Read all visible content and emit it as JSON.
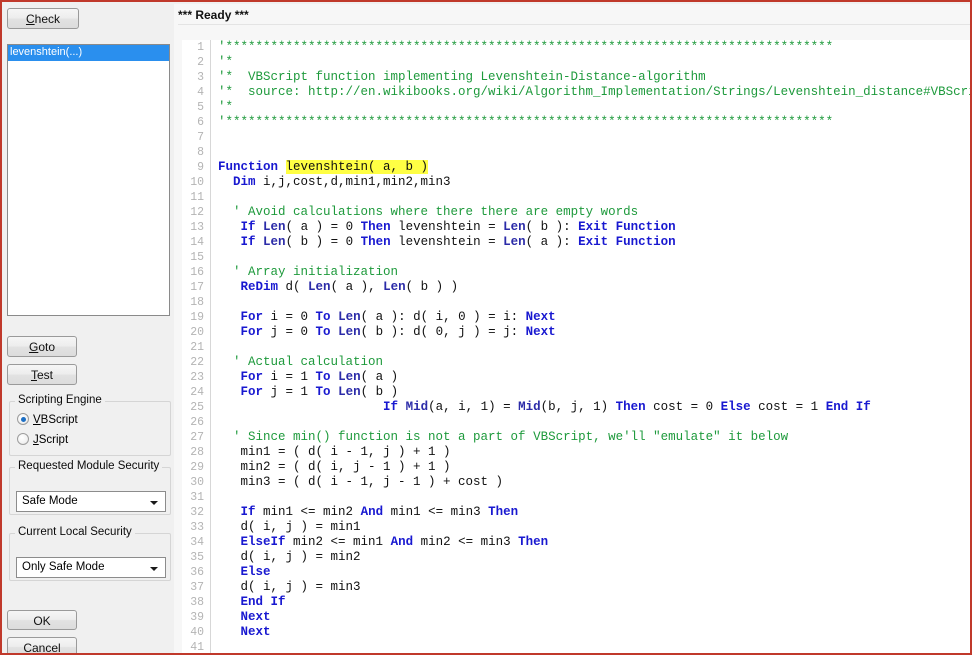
{
  "window": {
    "border_color": "#c0392b"
  },
  "sidebar": {
    "check_button": {
      "label": "Check",
      "accel": "C"
    },
    "function_list": {
      "items": [
        {
          "label": "levenshtein(...)",
          "selected": true
        }
      ]
    },
    "goto_button": {
      "label": "Goto",
      "accel": "G"
    },
    "test_button": {
      "label": "Test",
      "accel": "T"
    },
    "scripting_engine": {
      "title": "Scripting Engine",
      "options": [
        {
          "label": "VBScript",
          "accel": "V",
          "checked": true
        },
        {
          "label": "JScript",
          "accel": "J",
          "checked": false
        }
      ]
    },
    "module_security": {
      "title": "Requested Module Security",
      "value": "Safe Mode",
      "options": [
        "Safe Mode"
      ]
    },
    "local_security": {
      "title": "Current Local Security",
      "value": "Only Safe Mode",
      "options": [
        "Only Safe Mode"
      ]
    },
    "ok_button": {
      "label": "OK"
    },
    "cancel_button": {
      "label": "Cancel",
      "accel": "a"
    }
  },
  "editor": {
    "status": "*** Ready ***",
    "language": "VBScript",
    "colors": {
      "comment": "#1e9a3c",
      "keyword": "#1818d0",
      "builtin": "#2b2ba8",
      "identifier": "#101010",
      "highlight_bg": "#ffff44",
      "gutter_text": "#b4b4b4",
      "background": "#ffffff"
    },
    "lines": [
      {
        "n": 1,
        "tokens": [
          {
            "t": "cm",
            "s": "'*********************************************************************************"
          }
        ]
      },
      {
        "n": 2,
        "tokens": [
          {
            "t": "cm",
            "s": "'*"
          }
        ]
      },
      {
        "n": 3,
        "tokens": [
          {
            "t": "cm",
            "s": "'*  VBScript function implementing Levenshtein-Distance-algorithm"
          }
        ]
      },
      {
        "n": 4,
        "tokens": [
          {
            "t": "cm",
            "s": "'*  source: http://en.wikibooks.org/wiki/Algorithm_Implementation/Strings/Levenshtein_distance#VBScript"
          }
        ]
      },
      {
        "n": 5,
        "tokens": [
          {
            "t": "cm",
            "s": "'*"
          }
        ]
      },
      {
        "n": 6,
        "tokens": [
          {
            "t": "cm",
            "s": "'*********************************************************************************"
          }
        ]
      },
      {
        "n": 7,
        "tokens": []
      },
      {
        "n": 8,
        "tokens": []
      },
      {
        "n": 9,
        "tokens": [
          {
            "t": "kw",
            "s": "Function"
          },
          {
            "t": "id",
            "s": " "
          },
          {
            "t": "hl",
            "s": "levenshtein( a, b )"
          }
        ]
      },
      {
        "n": 10,
        "tokens": [
          {
            "t": "id",
            "s": "  "
          },
          {
            "t": "kw",
            "s": "Dim"
          },
          {
            "t": "id",
            "s": " i,j,cost,d,min1,min2,min3"
          }
        ]
      },
      {
        "n": 11,
        "tokens": []
      },
      {
        "n": 12,
        "tokens": [
          {
            "t": "id",
            "s": "  "
          },
          {
            "t": "cm",
            "s": "' Avoid calculations where there there are empty words"
          }
        ]
      },
      {
        "n": 13,
        "tokens": [
          {
            "t": "id",
            "s": "   "
          },
          {
            "t": "kw",
            "s": "If"
          },
          {
            "t": "id",
            "s": " "
          },
          {
            "t": "fn",
            "s": "Len"
          },
          {
            "t": "id",
            "s": "( a ) = 0 "
          },
          {
            "t": "kw",
            "s": "Then"
          },
          {
            "t": "id",
            "s": " levenshtein = "
          },
          {
            "t": "fn",
            "s": "Len"
          },
          {
            "t": "id",
            "s": "( b ): "
          },
          {
            "t": "kw",
            "s": "Exit Function"
          }
        ]
      },
      {
        "n": 14,
        "tokens": [
          {
            "t": "id",
            "s": "   "
          },
          {
            "t": "kw",
            "s": "If"
          },
          {
            "t": "id",
            "s": " "
          },
          {
            "t": "fn",
            "s": "Len"
          },
          {
            "t": "id",
            "s": "( b ) = 0 "
          },
          {
            "t": "kw",
            "s": "Then"
          },
          {
            "t": "id",
            "s": " levenshtein = "
          },
          {
            "t": "fn",
            "s": "Len"
          },
          {
            "t": "id",
            "s": "( a ): "
          },
          {
            "t": "kw",
            "s": "Exit Function"
          }
        ]
      },
      {
        "n": 15,
        "tokens": []
      },
      {
        "n": 16,
        "tokens": [
          {
            "t": "id",
            "s": "  "
          },
          {
            "t": "cm",
            "s": "' Array initialization"
          }
        ]
      },
      {
        "n": 17,
        "tokens": [
          {
            "t": "id",
            "s": "   "
          },
          {
            "t": "kw",
            "s": "ReDim"
          },
          {
            "t": "id",
            "s": " d( "
          },
          {
            "t": "fn",
            "s": "Len"
          },
          {
            "t": "id",
            "s": "( a ), "
          },
          {
            "t": "fn",
            "s": "Len"
          },
          {
            "t": "id",
            "s": "( b ) )"
          }
        ]
      },
      {
        "n": 18,
        "tokens": []
      },
      {
        "n": 19,
        "tokens": [
          {
            "t": "id",
            "s": "   "
          },
          {
            "t": "kw",
            "s": "For"
          },
          {
            "t": "id",
            "s": " i = 0 "
          },
          {
            "t": "kw",
            "s": "To"
          },
          {
            "t": "id",
            "s": " "
          },
          {
            "t": "fn",
            "s": "Len"
          },
          {
            "t": "id",
            "s": "( a ): d( i, 0 ) = i: "
          },
          {
            "t": "kw",
            "s": "Next"
          }
        ]
      },
      {
        "n": 20,
        "tokens": [
          {
            "t": "id",
            "s": "   "
          },
          {
            "t": "kw",
            "s": "For"
          },
          {
            "t": "id",
            "s": " j = 0 "
          },
          {
            "t": "kw",
            "s": "To"
          },
          {
            "t": "id",
            "s": " "
          },
          {
            "t": "fn",
            "s": "Len"
          },
          {
            "t": "id",
            "s": "( b ): d( 0, j ) = j: "
          },
          {
            "t": "kw",
            "s": "Next"
          }
        ]
      },
      {
        "n": 21,
        "tokens": []
      },
      {
        "n": 22,
        "tokens": [
          {
            "t": "id",
            "s": "  "
          },
          {
            "t": "cm",
            "s": "' Actual calculation"
          }
        ]
      },
      {
        "n": 23,
        "tokens": [
          {
            "t": "id",
            "s": "   "
          },
          {
            "t": "kw",
            "s": "For"
          },
          {
            "t": "id",
            "s": " i = 1 "
          },
          {
            "t": "kw",
            "s": "To"
          },
          {
            "t": "id",
            "s": " "
          },
          {
            "t": "fn",
            "s": "Len"
          },
          {
            "t": "id",
            "s": "( a )"
          }
        ]
      },
      {
        "n": 24,
        "tokens": [
          {
            "t": "id",
            "s": "   "
          },
          {
            "t": "kw",
            "s": "For"
          },
          {
            "t": "id",
            "s": " j = 1 "
          },
          {
            "t": "kw",
            "s": "To"
          },
          {
            "t": "id",
            "s": " "
          },
          {
            "t": "fn",
            "s": "Len"
          },
          {
            "t": "id",
            "s": "( b )"
          }
        ]
      },
      {
        "n": 25,
        "tokens": [
          {
            "t": "id",
            "s": "                      "
          },
          {
            "t": "kw",
            "s": "If"
          },
          {
            "t": "id",
            "s": " "
          },
          {
            "t": "fn",
            "s": "Mid"
          },
          {
            "t": "id",
            "s": "(a, i, 1) = "
          },
          {
            "t": "fn",
            "s": "Mid"
          },
          {
            "t": "id",
            "s": "(b, j, 1) "
          },
          {
            "t": "kw",
            "s": "Then"
          },
          {
            "t": "id",
            "s": " cost = 0 "
          },
          {
            "t": "kw",
            "s": "Else"
          },
          {
            "t": "id",
            "s": " cost = 1 "
          },
          {
            "t": "kw",
            "s": "End If"
          }
        ]
      },
      {
        "n": 26,
        "tokens": []
      },
      {
        "n": 27,
        "tokens": [
          {
            "t": "id",
            "s": "  "
          },
          {
            "t": "cm",
            "s": "' Since min() function is not a part of VBScript, we'll \"emulate\" it below"
          }
        ]
      },
      {
        "n": 28,
        "tokens": [
          {
            "t": "id",
            "s": "   min1 = ( d( i - 1, j ) + 1 )"
          }
        ]
      },
      {
        "n": 29,
        "tokens": [
          {
            "t": "id",
            "s": "   min2 = ( d( i, j - 1 ) + 1 )"
          }
        ]
      },
      {
        "n": 30,
        "tokens": [
          {
            "t": "id",
            "s": "   min3 = ( d( i - 1, j - 1 ) + cost )"
          }
        ]
      },
      {
        "n": 31,
        "tokens": []
      },
      {
        "n": 32,
        "tokens": [
          {
            "t": "id",
            "s": "   "
          },
          {
            "t": "kw",
            "s": "If"
          },
          {
            "t": "id",
            "s": " min1 <= min2 "
          },
          {
            "t": "kw",
            "s": "And"
          },
          {
            "t": "id",
            "s": " min1 <= min3 "
          },
          {
            "t": "kw",
            "s": "Then"
          }
        ]
      },
      {
        "n": 33,
        "tokens": [
          {
            "t": "id",
            "s": "   d( i, j ) = min1"
          }
        ]
      },
      {
        "n": 34,
        "tokens": [
          {
            "t": "id",
            "s": "   "
          },
          {
            "t": "kw",
            "s": "ElseIf"
          },
          {
            "t": "id",
            "s": " min2 <= min1 "
          },
          {
            "t": "kw",
            "s": "And"
          },
          {
            "t": "id",
            "s": " min2 <= min3 "
          },
          {
            "t": "kw",
            "s": "Then"
          }
        ]
      },
      {
        "n": 35,
        "tokens": [
          {
            "t": "id",
            "s": "   d( i, j ) = min2"
          }
        ]
      },
      {
        "n": 36,
        "tokens": [
          {
            "t": "id",
            "s": "   "
          },
          {
            "t": "kw",
            "s": "Else"
          }
        ]
      },
      {
        "n": 37,
        "tokens": [
          {
            "t": "id",
            "s": "   d( i, j ) = min3"
          }
        ]
      },
      {
        "n": 38,
        "tokens": [
          {
            "t": "id",
            "s": "   "
          },
          {
            "t": "kw",
            "s": "End If"
          }
        ]
      },
      {
        "n": 39,
        "tokens": [
          {
            "t": "id",
            "s": "   "
          },
          {
            "t": "kw",
            "s": "Next"
          }
        ]
      },
      {
        "n": 40,
        "tokens": [
          {
            "t": "id",
            "s": "   "
          },
          {
            "t": "kw",
            "s": "Next"
          }
        ]
      },
      {
        "n": 41,
        "tokens": []
      }
    ]
  }
}
